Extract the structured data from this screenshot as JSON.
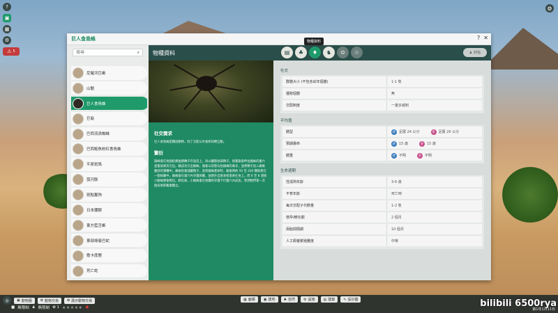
{
  "panel": {
    "title": "巨人食鳥蛛",
    "help": "?",
    "close": "✕"
  },
  "tooltip": "物種資料",
  "sidebar": {
    "search_placeholder": "搜尋",
    "items": [
      {
        "label": "尼羅河巨蜥",
        "active": false
      },
      {
        "label": "山魈",
        "active": false
      },
      {
        "label": "巨人食鳥蛛",
        "active": true
      },
      {
        "label": "巨龜",
        "active": false
      },
      {
        "label": "巴西流浪蜘蛛",
        "active": false
      },
      {
        "label": "巴西鮭魚粉紅食鳥蛛",
        "active": false
      },
      {
        "label": "平原斑馬",
        "active": false
      },
      {
        "label": "弧河豚",
        "active": false
      },
      {
        "label": "斑點鬣狗",
        "active": false
      },
      {
        "label": "日本獼猴",
        "active": false
      },
      {
        "label": "東方藍舌蜥",
        "active": false
      },
      {
        "label": "東部綠曼巴蛇",
        "active": false
      },
      {
        "label": "歌卡度鹿",
        "active": false
      },
      {
        "label": "死亡蛇",
        "active": false
      }
    ]
  },
  "content": {
    "title": "物種資料",
    "toggle_label": "終點"
  },
  "description": {
    "social_title": "社交需求",
    "social_text": "巨人食鳥蛛是獨居動物，除了交配以外會和同類互動。",
    "breeding_title": "繁衍",
    "breeding_text": "雄蛛會在地面結網並跳轉子存放其上，再以觸肢收取精子。接著雄會伸拉雌蛛的巢穴並嘗試將其引出。藉成功引出雌蛛，雄會以前肢勾住雌蛛的毒牙，並將精子送入雌蛛腹部的溝槽中。雌蛛則會儲藏精子，直到雌蛛產卵時，雌會將約 50 至 200 顆卵產在一個絲囊中。雌蛛會在巢穴內守護卵囊，並替外出覓食者進貢在身上。而 6 至 8 週後小雌蛛便會孵化。孵化後，小雌蛛會在地鑽的守護下打童六內成長，等到牠們第一次脫皮後即離巢獨立。"
  },
  "sections": [
    {
      "title": "社交",
      "rows": [
        {
          "label": "群體大小 (不包含幼年個體)",
          "value": "1-1 隻"
        },
        {
          "label": "優勢個體",
          "value": "無"
        },
        {
          "label": "交配制度",
          "value": "一雄多雌制"
        }
      ]
    },
    {
      "title": "平均值",
      "rows": [
        {
          "label": "體型",
          "male": "足展 24 公分",
          "female": "足展 26 公分"
        },
        {
          "label": "預期壽命",
          "male": "15 歲",
          "female": "15 歲"
        },
        {
          "label": "體重",
          "male": "不明",
          "female": "不明"
        }
      ]
    },
    {
      "title": "生命週期",
      "rows": [
        {
          "label": "性成熟年齡",
          "value": "3-6 歲"
        },
        {
          "label": "不育年齡",
          "value": "死亡時"
        },
        {
          "label": "每次交配子代數量",
          "value": "1-2 隻"
        },
        {
          "label": "懷孕/孵化期",
          "value": "2 個月"
        },
        {
          "label": "兩胎間隔期",
          "value": "10 個月"
        },
        {
          "label": "人工飼養繁殖難度",
          "value": "中等"
        }
      ]
    }
  ],
  "bottom": {
    "left_buttons": [
      "動物園",
      "動物交易",
      "展示動物交易"
    ],
    "money": "無限制",
    "guests": "無限制",
    "center_buttons": [
      "面積",
      "建地",
      "自然",
      "設施",
      "建築",
      "設計圖"
    ],
    "stars": "★★★★★",
    "date": "第1年1月11日",
    "watermark": "bilibili 6500rya"
  },
  "colors": {
    "accent": "#1f9a6b",
    "topbar": "#2a4e4a",
    "male": "#3f7fbf",
    "female": "#c74f8c"
  }
}
